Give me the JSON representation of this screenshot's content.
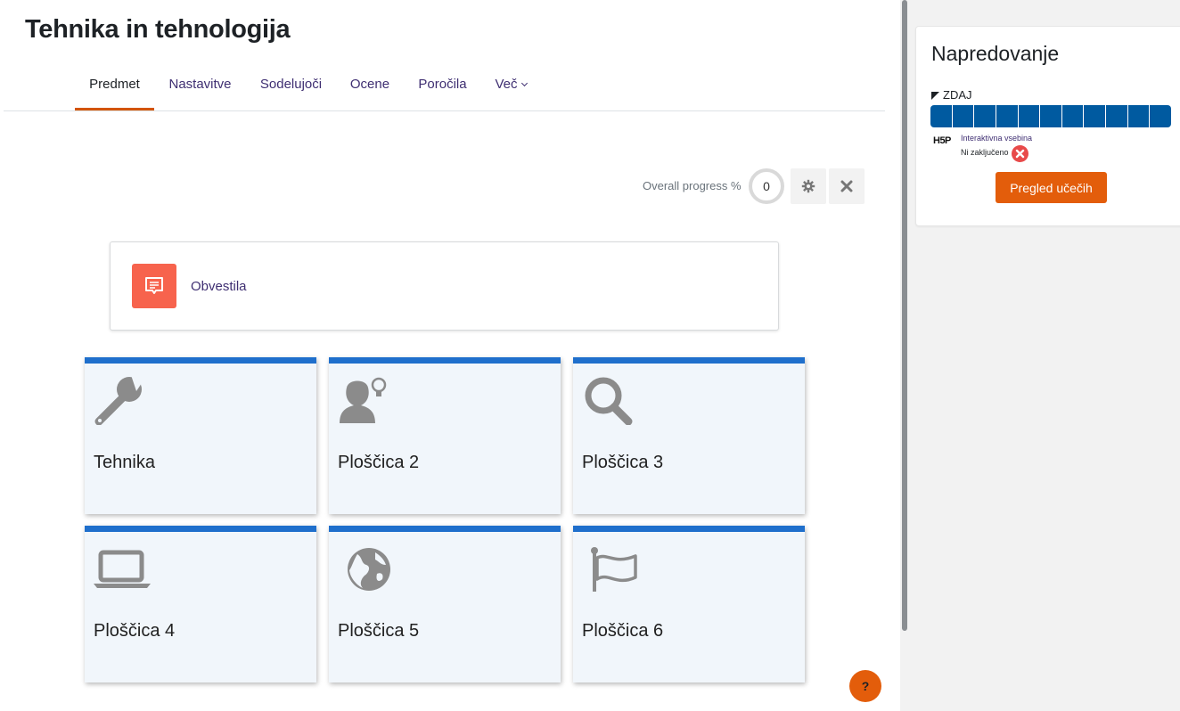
{
  "page": {
    "title": "Tehnika in tehnologija"
  },
  "nav": {
    "tabs": [
      {
        "label": "Predmet",
        "active": true
      },
      {
        "label": "Nastavitve"
      },
      {
        "label": "Sodelujoči"
      },
      {
        "label": "Ocene"
      },
      {
        "label": "Poročila"
      },
      {
        "label": "Več"
      }
    ]
  },
  "progress": {
    "label": "Overall progress %",
    "value": "0"
  },
  "announcements": {
    "label": "Obvestila",
    "icon": "announcement-icon"
  },
  "tiles": [
    {
      "label": "Tehnika",
      "icon": "wrench-icon"
    },
    {
      "label": "Ploščica 2",
      "icon": "person-idea-icon"
    },
    {
      "label": "Ploščica 3",
      "icon": "magnifier-icon"
    },
    {
      "label": "Ploščica 4",
      "icon": "laptop-icon"
    },
    {
      "label": "Ploščica 5",
      "icon": "globe-icon"
    },
    {
      "label": "Ploščica 6",
      "icon": "flag-icon"
    }
  ],
  "help": {
    "label": "?"
  },
  "side_block": {
    "title": "Napredovanje",
    "now_label": "ZDAJ",
    "progress_cells": 11,
    "activity": {
      "logo": "H5P",
      "name": "Interaktivna vsebina",
      "status": "Ni zaključeno"
    },
    "button_label": "Pregled učečih"
  },
  "colors": {
    "accent": "#e35d0b",
    "tile_border": "#1f6fcc",
    "tile_bg": "#f1f6fb",
    "progress_cell": "#005aa0",
    "announce_icon_bg": "#f7634d"
  }
}
